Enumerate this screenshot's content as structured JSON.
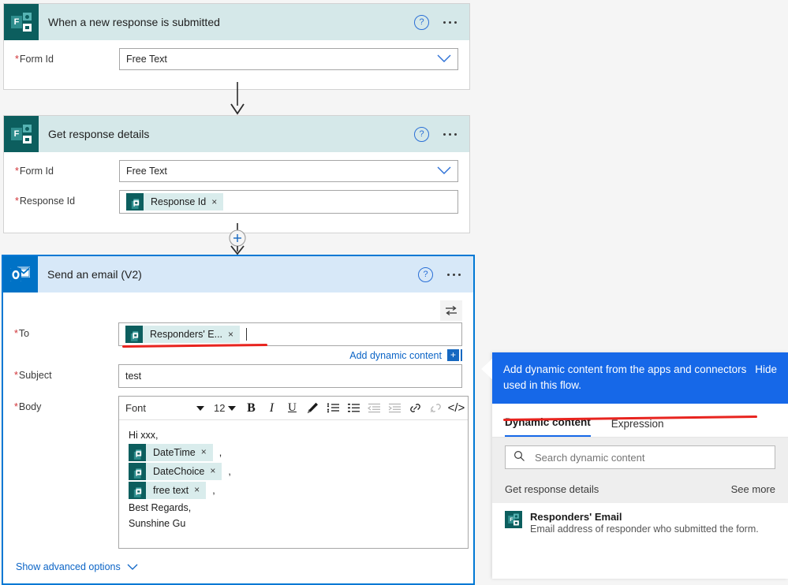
{
  "canvas": {
    "background": "#f5f5f5"
  },
  "cards": [
    {
      "id": "trigger",
      "title": "When a new response is submitted",
      "connector": "microsoft-forms",
      "header_color": "#d5e8e9",
      "icon_color": "#0c5e5e",
      "help_label": "?",
      "fields": [
        {
          "label": "Form Id",
          "required": true,
          "type": "dropdown",
          "value": "Free Text"
        }
      ]
    },
    {
      "id": "get-response-details",
      "title": "Get response details",
      "connector": "microsoft-forms",
      "header_color": "#d5e8e9",
      "icon_color": "#0c5e5e",
      "help_label": "?",
      "fields": [
        {
          "label": "Form Id",
          "required": true,
          "type": "dropdown",
          "value": "Free Text"
        },
        {
          "label": "Response Id",
          "required": true,
          "type": "token",
          "token": "Response Id",
          "token_close": "×"
        }
      ]
    },
    {
      "id": "send-an-email-v2",
      "title": "Send an email (V2)",
      "connector": "office-365-outlook",
      "header_color": "#d7e8f8",
      "icon_color": "#0072c6",
      "help_label": "?",
      "selected": true,
      "selected_border": "#0078d4"
    }
  ],
  "email": {
    "to": {
      "label": "To",
      "required": true,
      "token": "Responders' E...",
      "token_close": "×"
    },
    "add_dynamic_content": "Add dynamic content",
    "add_dynamic_plus": "+",
    "subject": {
      "label": "Subject",
      "required": true,
      "value": "test"
    },
    "body": {
      "label": "Body",
      "required": true,
      "toolbar": {
        "font_label": "Font",
        "size_label": "12",
        "bold": "B",
        "italic": "I",
        "underline": "U",
        "highlight_icon": "pen-icon",
        "numbered_list_icon": "numbered-list-icon",
        "bullet_list_icon": "bullet-list-icon",
        "outdent_icon": "outdent-icon",
        "indent_icon": "indent-icon",
        "link_icon": "link-icon",
        "unlink_icon": "unlink-icon",
        "code_icon": "</>"
      },
      "lines": [
        {
          "kind": "text",
          "text": "Hi xxx,"
        },
        {
          "kind": "token",
          "token": "DateTime",
          "token_close": "×",
          "trailing": ","
        },
        {
          "kind": "token",
          "token": "DateChoice",
          "token_close": "×",
          "trailing": ","
        },
        {
          "kind": "token",
          "token": "free text",
          "token_close": "×",
          "trailing": ","
        },
        {
          "kind": "text",
          "text": "Best Regards,"
        },
        {
          "kind": "text",
          "text": "Sunshine Gu"
        }
      ]
    },
    "show_advanced_options": "Show advanced options"
  },
  "dynamic_panel": {
    "banner": "Add dynamic content from the apps and connectors used in this flow.",
    "hide_label": "Hide",
    "banner_color": "#1668e8",
    "tabs": [
      {
        "label": "Dynamic content",
        "active": true
      },
      {
        "label": "Expression",
        "active": false
      }
    ],
    "search_placeholder": "Search dynamic content",
    "group": {
      "name": "Get response details",
      "see_more": "See more"
    },
    "items": [
      {
        "title": "Responders' Email",
        "description": "Email address of responder who submitted the form."
      }
    ]
  },
  "annotations": {
    "color": "#e8241f",
    "marks": [
      {
        "target": "to-field-underline"
      },
      {
        "target": "responders-email-item-underline"
      }
    ]
  }
}
